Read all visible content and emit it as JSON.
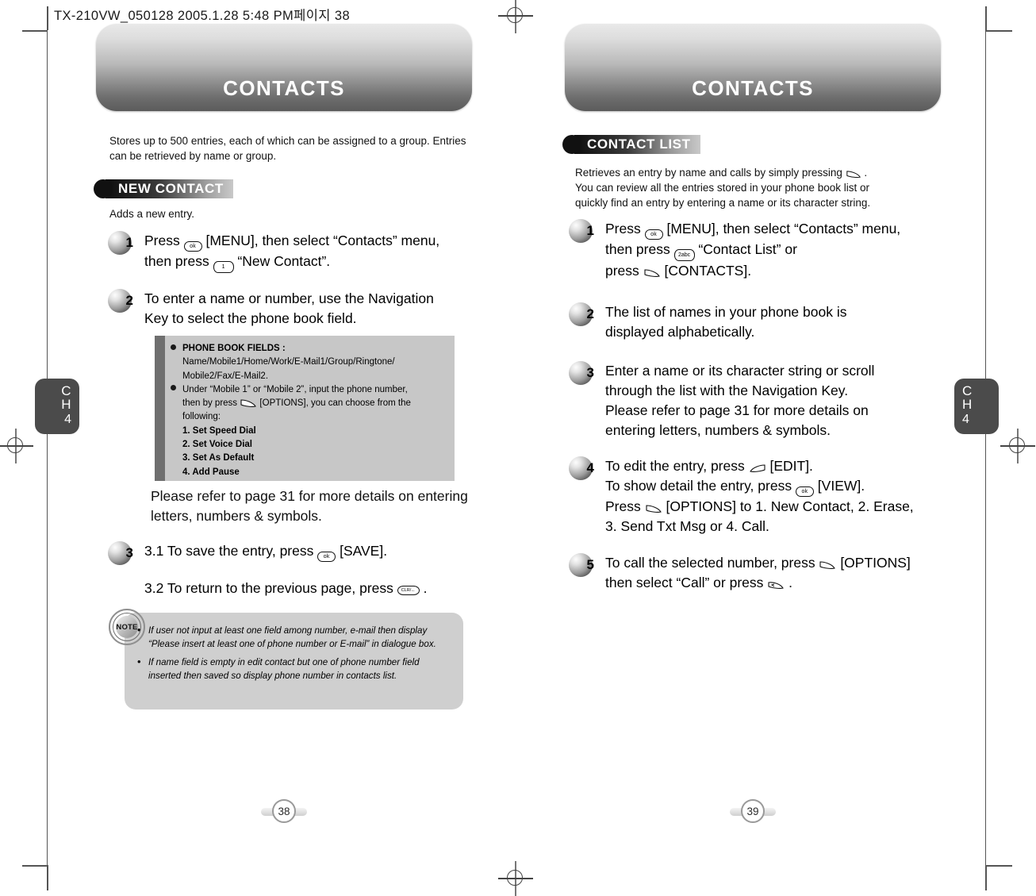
{
  "document": {
    "file_header": "TX-210VW_050128  2005.1.28 5:48 PM페이지 38"
  },
  "left_page": {
    "banner_title": "CONTACTS",
    "intro": "Stores up to 500 entries, each of which can be assigned to a group. Entries can be retrieved by name or group.",
    "section_heading": "NEW CONTACT",
    "section_sub": "Adds a new entry.",
    "steps": [
      {
        "number": "1",
        "line1_a": "Press ",
        "line1_b": " [MENU], then select “Contacts” menu,",
        "line2_a": "then press ",
        "line2_b": " “New Contact”."
      },
      {
        "number": "2",
        "line1": "To enter a name or number, use the Navigation",
        "line2": "Key to select the phone book field."
      },
      {
        "number": "3",
        "line1_a": "3.1 To save the entry, press ",
        "line1_b": " [SAVE].",
        "line2_a": "3.2 To return to the previous page, press ",
        "line2_b": " ."
      }
    ],
    "info_box": {
      "bullet1_title": "PHONE BOOK FIELDS :",
      "bullet1_line1": "Name/Mobile1/Home/Work/E-Mail1/Group/Ringtone/",
      "bullet1_line2": "Mobile2/Fax/E-Mail2.",
      "bullet2_line1": "Under “Mobile 1” or “Mobile 2”, input the phone number,",
      "bullet2_line2_a": "then by press ",
      "bullet2_line2_b": " [OPTIONS], you can choose from the",
      "bullet2_line3": "following:",
      "options": [
        "1. Set Speed Dial",
        "2. Set Voice Dial",
        "3. Set As Default",
        "4. Add Pause"
      ]
    },
    "after_box_text": "Please refer to page 31 for more details on entering letters, numbers & symbols.",
    "note": {
      "icon_label": "NOTE",
      "items": [
        "If user not input at least one field among number, e-mail then display “Please insert at least one of phone number or E-mail” in dialogue box.",
        "If name field is empty in edit contact but one of phone number field inserted then saved so display phone number in contacts list."
      ]
    },
    "chapter_tab": {
      "ch": "C",
      "h": "H",
      "number": "4"
    },
    "page_number": "38"
  },
  "right_page": {
    "banner_title": "CONTACTS",
    "section_heading": "CONTACT LIST",
    "intro_line1_a": "Retrieves an entry by name and calls by simply pressing ",
    "intro_line1_b": " .",
    "intro_line2": "You can review all the entries stored in your phone book list or",
    "intro_line3": "quickly find an entry by entering a name or its character string.",
    "steps": [
      {
        "number": "1",
        "line1_a": "Press ",
        "line1_b": " [MENU], then select “Contacts” menu,",
        "line2_a": "then press ",
        "line2_b": " “Contact List” or",
        "line3_a": "press ",
        "line3_b": " [CONTACTS]."
      },
      {
        "number": "2",
        "line1": "The list of names in your phone book is",
        "line2": "displayed alphabetically."
      },
      {
        "number": "3",
        "line1": "Enter a name or its character string or scroll",
        "line2": "through the list with the Navigation Key.",
        "line3": "Please refer to page 31 for more details on",
        "line4": "entering letters, numbers & symbols."
      },
      {
        "number": "4",
        "line1_a": "To edit the entry, press ",
        "line1_b": " [EDIT].",
        "line2_a": "To show detail the entry, press ",
        "line2_b": " [VIEW].",
        "line3_a": "Press ",
        "line3_b": " [OPTIONS] to 1. New Contact, 2. Erase,",
        "line4": "3. Send Txt Msg or 4. Call."
      },
      {
        "number": "5",
        "line1_a": "To call the selected number, press ",
        "line1_b": " [OPTIONS]",
        "line2_a": "then select “Call” or press ",
        "line2_b": " ."
      }
    ],
    "chapter_tab": {
      "ch": "C",
      "h": "H",
      "number": "4"
    },
    "page_number": "39"
  },
  "keys": {
    "ok_label": "ok",
    "one_label": "1",
    "two_label": "2abc",
    "clear_label": "CLR/←"
  }
}
